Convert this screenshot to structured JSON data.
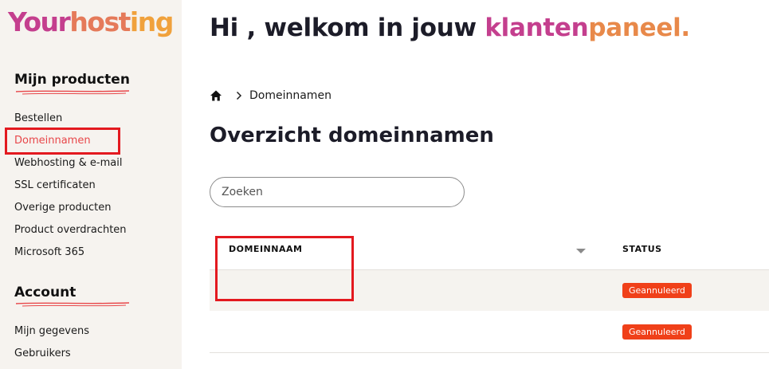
{
  "brand": {
    "logo_part1": "Your",
    "logo_part2": "host",
    "logo_part3": "ing"
  },
  "sidebar": {
    "section1": {
      "heading": "Mijn producten",
      "items": [
        {
          "label": "Bestellen"
        },
        {
          "label": "Domeinnamen"
        },
        {
          "label": "Webhosting & e-mail"
        },
        {
          "label": "SSL certificaten"
        },
        {
          "label": "Overige producten"
        },
        {
          "label": "Product overdrachten"
        },
        {
          "label": "Microsoft 365"
        }
      ]
    },
    "section2": {
      "heading": "Account",
      "items": [
        {
          "label": "Mijn gegevens"
        },
        {
          "label": "Gebruikers"
        }
      ]
    }
  },
  "header": {
    "title_plain": "Hi , welkom in jouw ",
    "title_hl1": "klanten",
    "title_hl2": "paneel."
  },
  "breadcrumb": {
    "current": "Domeinnamen"
  },
  "page": {
    "title": "Overzicht domeinnamen"
  },
  "search": {
    "placeholder": "Zoeken",
    "value": ""
  },
  "table": {
    "columns": [
      "DOMEINNAAM",
      "STATUS"
    ],
    "rows": [
      {
        "domain": "",
        "status": "Geannuleerd"
      },
      {
        "domain": "",
        "status": "Geannuleerd"
      }
    ]
  },
  "colors": {
    "accent": "#e8474a",
    "status_cancelled": "#f04019",
    "sidebar_bg": "#f6f3ef"
  }
}
